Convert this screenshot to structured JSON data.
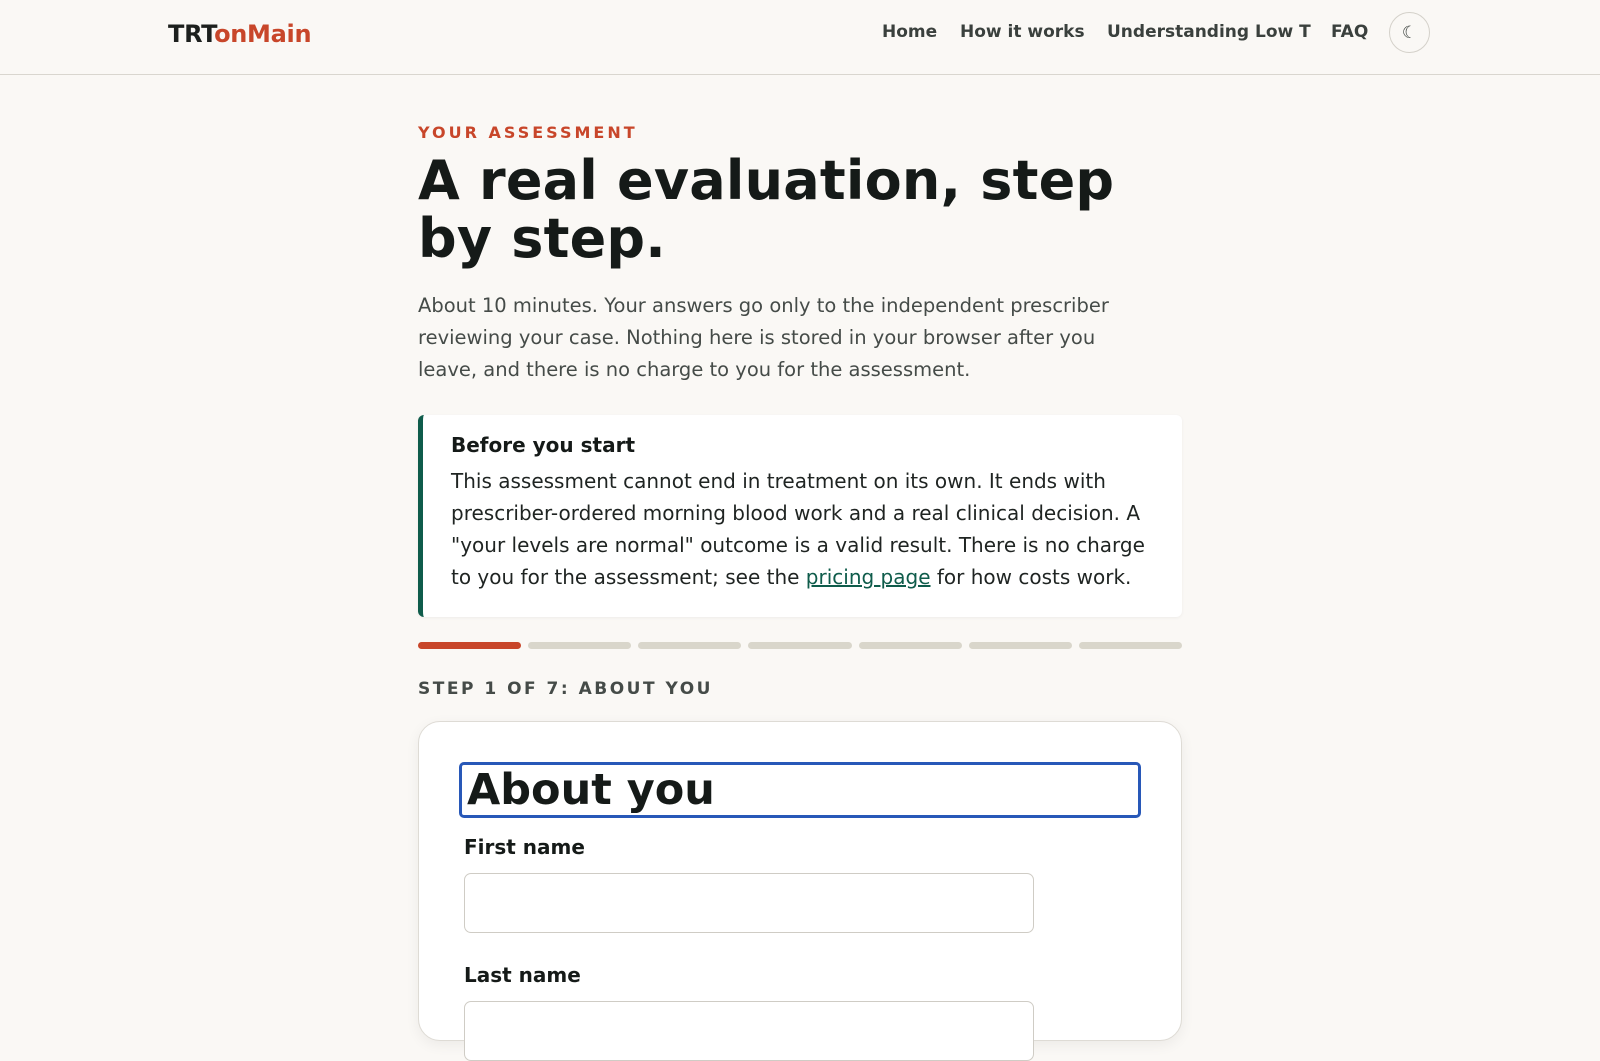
{
  "header": {
    "logo_part1": "TRT",
    "logo_part2": "onMain",
    "nav": [
      "Home",
      "How it works",
      "Understanding Low T",
      "FAQ"
    ],
    "theme_toggle_glyph": "☾",
    "theme_toggle_icon": "moon-icon"
  },
  "main": {
    "eyebrow": "YOUR ASSESSMENT",
    "title": "A real evaluation, step by step.",
    "intro": "About 10 minutes. Your answers go only to the independent prescriber reviewing your case. Nothing here is stored in your browser after you leave, and there is no charge to you for the assessment.",
    "callout": {
      "title": "Before you start",
      "text_before_link": "This assessment cannot end in treatment on its own. It ends with prescriber-ordered morning blood work and a real clinical decision. A \"your levels are normal\" outcome is a valid result. There is no charge to you for the assessment; see the ",
      "link_text": "pricing page",
      "text_after_link": " for how costs work."
    },
    "progress": {
      "current_step": 1,
      "total_steps": 7
    },
    "step_label": "STEP 1 OF 7: ABOUT YOU",
    "form": {
      "heading": "About you",
      "first_name_label": "First name",
      "first_name_value": "",
      "last_name_label": "Last name"
    }
  },
  "colors": {
    "accent": "#c8462a",
    "callout_border": "#0f5c4b",
    "focus_ring": "#2858b8",
    "background": "#faf8f5"
  }
}
